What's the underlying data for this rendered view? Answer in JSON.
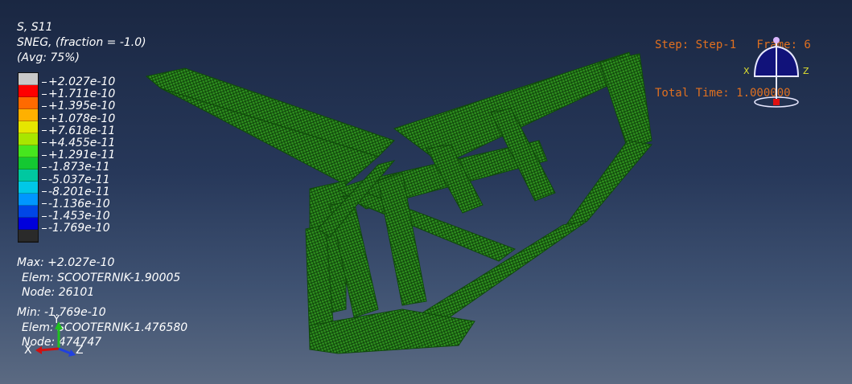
{
  "legend": {
    "title": "S, S11",
    "subtitle": "SNEG, (fraction = -1.0)",
    "averaging": "(Avg: 75%)",
    "levels": [
      "+2.027e-10",
      "+1.711e-10",
      "+1.395e-10",
      "+1.078e-10",
      "+7.618e-11",
      "+4.455e-11",
      "+1.291e-11",
      "-1.873e-11",
      "-5.037e-11",
      "-8.201e-11",
      "-1.136e-10",
      "-1.453e-10",
      "-1.769e-10"
    ],
    "swatch_colors": [
      "#c8c8c8",
      "#ff0000",
      "#ff6a00",
      "#ffb000",
      "#e6e600",
      "#a8e600",
      "#46e61e",
      "#14c832",
      "#00c8a0",
      "#00c8e6",
      "#0096ff",
      "#0046e6",
      "#0000dc",
      "#2a2a2a"
    ]
  },
  "max": {
    "value": "Max: +2.027e-10",
    "elem": "Elem: SCOOTERNIK-1.90005",
    "node": "Node: 26101"
  },
  "min": {
    "value": "Min: -1.769e-10",
    "elem": "Elem: SCOOTERNIK-1.476580",
    "node": "Node: 474747"
  },
  "step": {
    "line1": "Step: Step-1   Frame: 6",
    "line2": "Total Time: 1.000000"
  },
  "triad": {
    "view_labels": {
      "x": "X",
      "z": "Z"
    },
    "axis_labels": {
      "x": "X",
      "y": "Y",
      "z": "Z"
    },
    "colors": {
      "x": "#d01010",
      "y": "#20c020",
      "z": "#2040e0"
    }
  },
  "model": {
    "mesh_color": "#2e8f1f",
    "mesh_dark": "#0c3a08",
    "icon": "frame-mesh"
  }
}
